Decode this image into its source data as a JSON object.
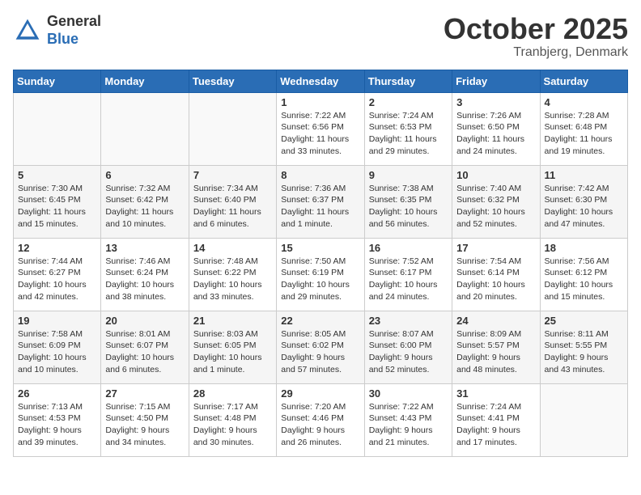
{
  "header": {
    "logo_general": "General",
    "logo_blue": "Blue",
    "month": "October 2025",
    "location": "Tranbjerg, Denmark"
  },
  "weekdays": [
    "Sunday",
    "Monday",
    "Tuesday",
    "Wednesday",
    "Thursday",
    "Friday",
    "Saturday"
  ],
  "weeks": [
    [
      {
        "day": "",
        "info": ""
      },
      {
        "day": "",
        "info": ""
      },
      {
        "day": "",
        "info": ""
      },
      {
        "day": "1",
        "info": "Sunrise: 7:22 AM\nSunset: 6:56 PM\nDaylight: 11 hours\nand 33 minutes."
      },
      {
        "day": "2",
        "info": "Sunrise: 7:24 AM\nSunset: 6:53 PM\nDaylight: 11 hours\nand 29 minutes."
      },
      {
        "day": "3",
        "info": "Sunrise: 7:26 AM\nSunset: 6:50 PM\nDaylight: 11 hours\nand 24 minutes."
      },
      {
        "day": "4",
        "info": "Sunrise: 7:28 AM\nSunset: 6:48 PM\nDaylight: 11 hours\nand 19 minutes."
      }
    ],
    [
      {
        "day": "5",
        "info": "Sunrise: 7:30 AM\nSunset: 6:45 PM\nDaylight: 11 hours\nand 15 minutes."
      },
      {
        "day": "6",
        "info": "Sunrise: 7:32 AM\nSunset: 6:42 PM\nDaylight: 11 hours\nand 10 minutes."
      },
      {
        "day": "7",
        "info": "Sunrise: 7:34 AM\nSunset: 6:40 PM\nDaylight: 11 hours\nand 6 minutes."
      },
      {
        "day": "8",
        "info": "Sunrise: 7:36 AM\nSunset: 6:37 PM\nDaylight: 11 hours\nand 1 minute."
      },
      {
        "day": "9",
        "info": "Sunrise: 7:38 AM\nSunset: 6:35 PM\nDaylight: 10 hours\nand 56 minutes."
      },
      {
        "day": "10",
        "info": "Sunrise: 7:40 AM\nSunset: 6:32 PM\nDaylight: 10 hours\nand 52 minutes."
      },
      {
        "day": "11",
        "info": "Sunrise: 7:42 AM\nSunset: 6:30 PM\nDaylight: 10 hours\nand 47 minutes."
      }
    ],
    [
      {
        "day": "12",
        "info": "Sunrise: 7:44 AM\nSunset: 6:27 PM\nDaylight: 10 hours\nand 42 minutes."
      },
      {
        "day": "13",
        "info": "Sunrise: 7:46 AM\nSunset: 6:24 PM\nDaylight: 10 hours\nand 38 minutes."
      },
      {
        "day": "14",
        "info": "Sunrise: 7:48 AM\nSunset: 6:22 PM\nDaylight: 10 hours\nand 33 minutes."
      },
      {
        "day": "15",
        "info": "Sunrise: 7:50 AM\nSunset: 6:19 PM\nDaylight: 10 hours\nand 29 minutes."
      },
      {
        "day": "16",
        "info": "Sunrise: 7:52 AM\nSunset: 6:17 PM\nDaylight: 10 hours\nand 24 minutes."
      },
      {
        "day": "17",
        "info": "Sunrise: 7:54 AM\nSunset: 6:14 PM\nDaylight: 10 hours\nand 20 minutes."
      },
      {
        "day": "18",
        "info": "Sunrise: 7:56 AM\nSunset: 6:12 PM\nDaylight: 10 hours\nand 15 minutes."
      }
    ],
    [
      {
        "day": "19",
        "info": "Sunrise: 7:58 AM\nSunset: 6:09 PM\nDaylight: 10 hours\nand 10 minutes."
      },
      {
        "day": "20",
        "info": "Sunrise: 8:01 AM\nSunset: 6:07 PM\nDaylight: 10 hours\nand 6 minutes."
      },
      {
        "day": "21",
        "info": "Sunrise: 8:03 AM\nSunset: 6:05 PM\nDaylight: 10 hours\nand 1 minute."
      },
      {
        "day": "22",
        "info": "Sunrise: 8:05 AM\nSunset: 6:02 PM\nDaylight: 9 hours\nand 57 minutes."
      },
      {
        "day": "23",
        "info": "Sunrise: 8:07 AM\nSunset: 6:00 PM\nDaylight: 9 hours\nand 52 minutes."
      },
      {
        "day": "24",
        "info": "Sunrise: 8:09 AM\nSunset: 5:57 PM\nDaylight: 9 hours\nand 48 minutes."
      },
      {
        "day": "25",
        "info": "Sunrise: 8:11 AM\nSunset: 5:55 PM\nDaylight: 9 hours\nand 43 minutes."
      }
    ],
    [
      {
        "day": "26",
        "info": "Sunrise: 7:13 AM\nSunset: 4:53 PM\nDaylight: 9 hours\nand 39 minutes."
      },
      {
        "day": "27",
        "info": "Sunrise: 7:15 AM\nSunset: 4:50 PM\nDaylight: 9 hours\nand 34 minutes."
      },
      {
        "day": "28",
        "info": "Sunrise: 7:17 AM\nSunset: 4:48 PM\nDaylight: 9 hours\nand 30 minutes."
      },
      {
        "day": "29",
        "info": "Sunrise: 7:20 AM\nSunset: 4:46 PM\nDaylight: 9 hours\nand 26 minutes."
      },
      {
        "day": "30",
        "info": "Sunrise: 7:22 AM\nSunset: 4:43 PM\nDaylight: 9 hours\nand 21 minutes."
      },
      {
        "day": "31",
        "info": "Sunrise: 7:24 AM\nSunset: 4:41 PM\nDaylight: 9 hours\nand 17 minutes."
      },
      {
        "day": "",
        "info": ""
      }
    ]
  ]
}
